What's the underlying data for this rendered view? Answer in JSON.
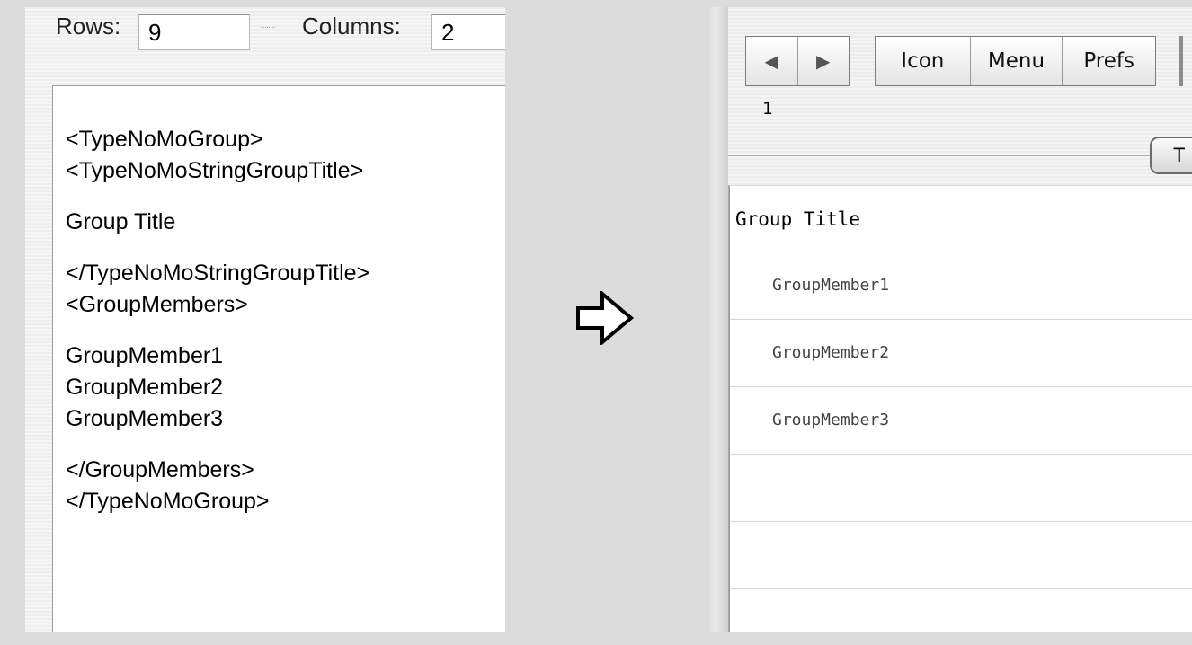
{
  "left": {
    "rows_label": "Rows:",
    "rows_value": "9",
    "columns_label": "Columns:",
    "columns_value": "2",
    "code_lines": [
      "<TypeNoMoGroup>",
      "<TypeNoMoStringGroupTitle>",
      "",
      "Group Title",
      "",
      "</TypeNoMoStringGroupTitle>",
      "<GroupMembers>",
      "",
      "GroupMember1",
      "GroupMember2",
      "GroupMember3",
      "",
      "</GroupMembers>",
      "</TypeNoMoGroup>"
    ]
  },
  "right": {
    "nav": {
      "back_icon": "◀",
      "forward_icon": "▶"
    },
    "buttons": {
      "icon": "Icon",
      "menu": "Menu",
      "prefs": "Prefs"
    },
    "page_number": "1",
    "tab_label": "T",
    "list": {
      "title": "Group Title",
      "rows": [
        "GroupMember1",
        "GroupMember2",
        "GroupMember3",
        "",
        "",
        ""
      ]
    }
  },
  "colors": {
    "background": "#dcdcdc",
    "border": "#7d7d7d"
  }
}
